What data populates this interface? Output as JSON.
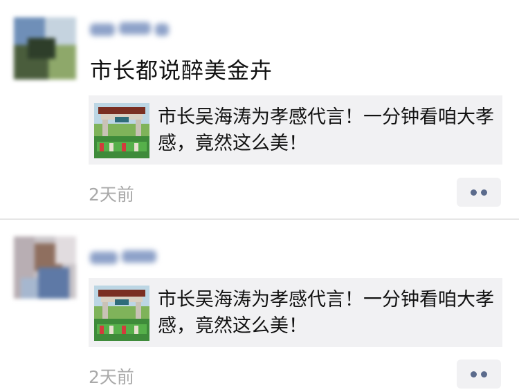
{
  "colors": {
    "username_blue": "#576b95",
    "timestamp_gray": "#a9a9a9",
    "card_bg": "#f1f1f3"
  },
  "posts": [
    {
      "text": "市长都说醉美金卉",
      "link_title": "市长吴海涛为孝感代言！一分钟看咱大孝感，竟然这么美！",
      "time": "2天前",
      "more_icon": "ellipsis-icon"
    },
    {
      "text": "",
      "link_title": "市长吴海涛为孝感代言！一分钟看咱大孝感，竟然这么美！",
      "time": "2天前",
      "more_icon": "ellipsis-icon"
    }
  ]
}
